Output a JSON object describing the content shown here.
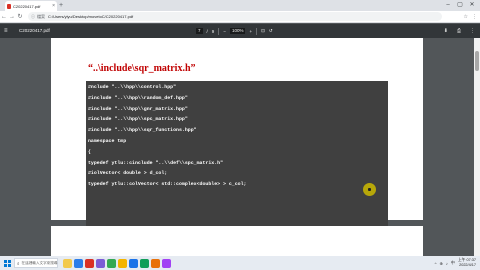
{
  "browser": {
    "tab_title": "C20220417.pdf",
    "tab_close": "×",
    "new_tab": "+",
    "window_controls": [
      "–",
      "▢",
      "✕"
    ],
    "nav": [
      "←",
      "→",
      "↻"
    ],
    "security_chip": "檔案",
    "url": "C:/Users/ylyu/Desktop/movetoC/C20220417.pdf",
    "omni_icons": [
      "☆",
      "⋮"
    ]
  },
  "pdf_toolbar": {
    "menu_icon": "≡",
    "filename": "C20220417.pdf",
    "page_current": "7",
    "page_sep": "/",
    "page_total": "9",
    "zoom_out": "−",
    "zoom_value": "100%",
    "zoom_in": "+",
    "fit_icon": "⊡",
    "rotate_icon": "↺",
    "download_icon": "⬇",
    "print_icon": "⎙",
    "more_icon": "⋮"
  },
  "document": {
    "heading": "“..\\include\\sqr_matrix.h”",
    "code_lines": [
      "#nclude \"..\\\\hpp\\\\control.hpp\"",
      "#include \"..\\\\hpp\\\\random_def.hpp\"",
      "#include \"..\\\\hpp\\\\gnr_matrix.hpp\"",
      "#include \"..\\\\hpp\\\\spc_matrix.hpp\"",
      "#include \"..\\\\hpp\\\\sqr_functions.hpp\"",
      "namespace tmp",
      "{",
      "typedef ytlu::cinclude \"..\\\\def\\\\spc_matrix.h\"",
      "#iolVector< double > d_col;",
      "typedef ytlu::colVector< std::complex<double> > c_col;"
    ]
  },
  "taskbar": {
    "search_icon": "⌕",
    "search_placeholder": "在這裡輸入文字來搜尋",
    "app_colors": [
      "#f2c94c",
      "#2b7de9",
      "#d93025",
      "#7b5cd6",
      "#34a853",
      "#f4b400",
      "#1a73e8",
      "#0f9d58",
      "#e8710a",
      "#a142f4"
    ],
    "tray_items": [
      "^",
      "⊕",
      "♪",
      "中"
    ],
    "time": "上午 07:37",
    "date": "2022/4/17"
  },
  "colors": {
    "heading": "#c00000",
    "code_background": "#404040",
    "cursor_highlight": "#ccba00"
  }
}
